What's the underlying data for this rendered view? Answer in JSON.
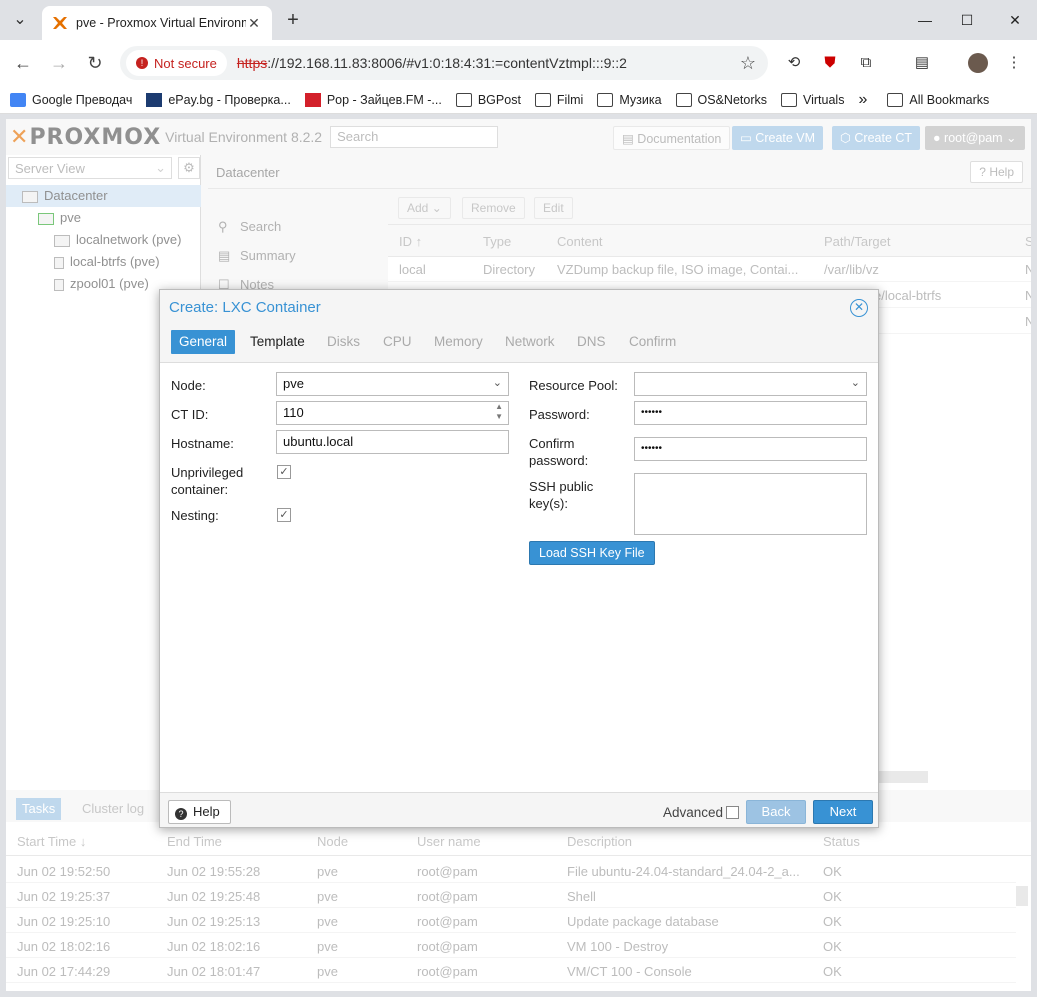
{
  "browser": {
    "tab_title": "pve - Proxmox Virtual Environment",
    "not_secure": "Not secure",
    "url_scheme": "https",
    "url_rest": "://192.168.11.83:8006/#v1:0:18:4:31:=contentVztmpl:::9::2",
    "bookmarks": [
      "Google Преводач",
      "ePay.bg - Проверка...",
      "Pop - Зайцев.FM -...",
      "BGPost",
      "Filmi",
      "Музика",
      "OS&Netorks",
      "Virtuals"
    ],
    "more": "»",
    "all_bookmarks": "All Bookmarks"
  },
  "pve": {
    "logo_text": "PROXMOX",
    "version": "Virtual Environment 8.2.2",
    "search_placeholder": "Search",
    "documentation": "Documentation",
    "create_vm": "Create VM",
    "create_ct": "Create CT",
    "user": "root@pam",
    "server_view": "Server View",
    "tree": [
      "Datacenter",
      "pve",
      "localnetwork (pve)",
      "local-btrfs (pve)",
      "zpool01 (pve)"
    ],
    "content_title": "Datacenter",
    "help": "Help",
    "nav": [
      "Search",
      "Summary",
      "Notes"
    ],
    "grid_buttons": [
      "Add",
      "Remove",
      "Edit"
    ],
    "grid_headers": [
      "ID",
      "Type",
      "Content",
      "Path/Target",
      "S"
    ],
    "grid_rows": [
      {
        "id": "local",
        "type": "Directory",
        "content": "VZDump backup file, ISO image, Contai...",
        "path": "/var/lib/vz",
        "s": "N"
      },
      {
        "id": "",
        "type": "",
        "content": "",
        "path": "e/local-btrfs",
        "s": "N"
      },
      {
        "id": "",
        "type": "",
        "content": "",
        "path": "",
        "s": "N"
      }
    ]
  },
  "bottom": {
    "tabs": [
      "Tasks",
      "Cluster log"
    ],
    "headers": [
      "Start Time",
      "End Time",
      "Node",
      "User name",
      "Description",
      "Status"
    ],
    "rows": [
      {
        "start": "Jun 02 19:52:50",
        "end": "Jun 02 19:55:28",
        "node": "pve",
        "user": "root@pam",
        "desc": "File ubuntu-24.04-standard_24.04-2_a...",
        "status": "OK"
      },
      {
        "start": "Jun 02 19:25:37",
        "end": "Jun 02 19:25:48",
        "node": "pve",
        "user": "root@pam",
        "desc": "Shell",
        "status": "OK"
      },
      {
        "start": "Jun 02 19:25:10",
        "end": "Jun 02 19:25:13",
        "node": "pve",
        "user": "root@pam",
        "desc": "Update package database",
        "status": "OK"
      },
      {
        "start": "Jun 02 18:02:16",
        "end": "Jun 02 18:02:16",
        "node": "pve",
        "user": "root@pam",
        "desc": "VM 100 - Destroy",
        "status": "OK"
      },
      {
        "start": "Jun 02 17:44:29",
        "end": "Jun 02 18:01:47",
        "node": "pve",
        "user": "root@pam",
        "desc": "VM/CT 100 - Console",
        "status": "OK"
      }
    ]
  },
  "dialog": {
    "title": "Create: LXC Container",
    "tabs": [
      "General",
      "Template",
      "Disks",
      "CPU",
      "Memory",
      "Network",
      "DNS",
      "Confirm"
    ],
    "node_label": "Node:",
    "node_value": "pve",
    "ctid_label": "CT ID:",
    "ctid_value": "110",
    "hostname_label": "Hostname:",
    "hostname_value": "ubuntu.local",
    "unpriv_label_1": "Unprivileged",
    "unpriv_label_2": "container:",
    "nesting_label": "Nesting:",
    "pool_label": "Resource Pool:",
    "pool_value": "",
    "password_label": "Password:",
    "password_value": "••••••",
    "confirm_label_1": "Confirm",
    "confirm_label_2": "password:",
    "confirm_value": "••••••",
    "ssh_label_1": "SSH public",
    "ssh_label_2": "key(s):",
    "load_ssh": "Load SSH Key File",
    "help": "Help",
    "advanced": "Advanced",
    "back": "Back",
    "next": "Next"
  },
  "colors": {
    "accent": "#3892d4",
    "brand": "#e57000",
    "not_secure": "#c5221f"
  }
}
